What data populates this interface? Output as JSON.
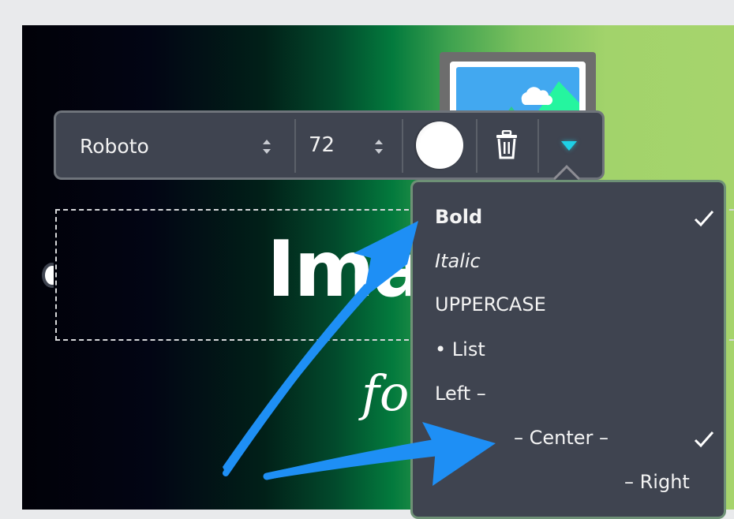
{
  "toolbar": {
    "font_family": "Roboto",
    "font_size": "72",
    "text_color": "#ffffff",
    "accent_color": "#1fd0e6",
    "icons": {
      "font_spinner": "up-down-spinner-icon",
      "size_spinner": "up-down-spinner-icon",
      "delete": "trash-icon",
      "more": "caret-down-icon"
    }
  },
  "canvas": {
    "headline": "Ima",
    "subline": "for"
  },
  "menu": {
    "items": [
      {
        "label": "Bold",
        "checked": true
      },
      {
        "label": "Italic",
        "checked": false
      },
      {
        "label": "UPPERCASE",
        "checked": false
      },
      {
        "label": "• List",
        "checked": false
      },
      {
        "label": "Left –",
        "checked": false
      },
      {
        "label": "– Center –",
        "checked": true
      },
      {
        "label": "– Right",
        "checked": false
      }
    ]
  },
  "annotations": {
    "arrow_color": "#1e8ff5"
  }
}
